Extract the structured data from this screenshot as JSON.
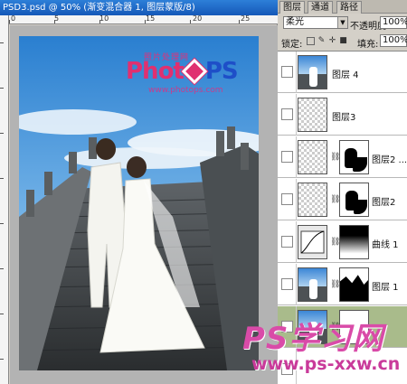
{
  "document": {
    "title": "PSD3.psd @ 50% (渐变混合器 1, 图层蒙版/8)",
    "ruler_marks": [
      "0",
      "5",
      "10",
      "15",
      "20",
      "25"
    ]
  },
  "photo": {
    "logo_top": "照片处理网",
    "logo_text_a": "Phot",
    "logo_text_b": "PS",
    "logo_url": "www.photops.com"
  },
  "panel": {
    "tabs": [
      "图层",
      "通道",
      "路径"
    ],
    "blend_mode": "柔光",
    "opacity_label": "不透明度:",
    "opacity_value": "100%",
    "lock_label": "锁定:",
    "fill_label": "填充:",
    "fill_value": "100%"
  },
  "layers": [
    {
      "name": "图层 4",
      "thumb": "photo"
    },
    {
      "name": "图层3",
      "thumb": "transparent"
    },
    {
      "name": "图层2 ...",
      "thumb": "transparent",
      "mask": "figure"
    },
    {
      "name": "图层2",
      "thumb": "transparent",
      "mask": "figure"
    },
    {
      "name": "曲线 1",
      "thumb": "curves",
      "mask": "gradient"
    },
    {
      "name": "图层 1",
      "thumb": "photo",
      "mask": "silhouette"
    },
    {
      "name": "",
      "thumb": "photo",
      "mask": "white",
      "selected": true
    }
  ],
  "watermark": {
    "title": "PS学习网",
    "url": "www.ps-xxw.cn"
  },
  "colors": {
    "title_bar": "#1558b8",
    "selected_layer": "#a9bb8b",
    "watermark": "#d94ba8"
  }
}
